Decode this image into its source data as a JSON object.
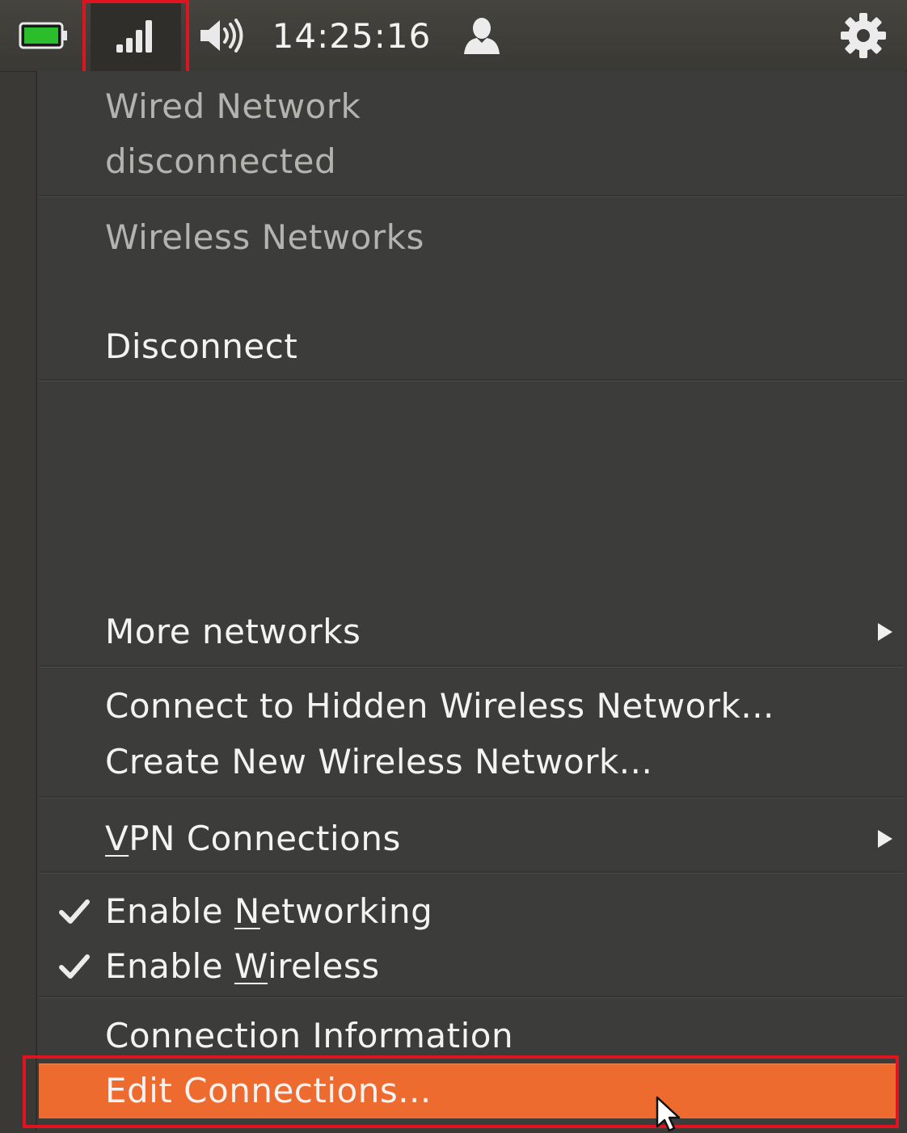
{
  "panel": {
    "battery_icon": "battery-full-icon",
    "network_icon": "network-signal-icon",
    "sound_icon": "speaker-volume-icon",
    "clock": "14:25:16",
    "user_icon": "user-icon",
    "gear_icon": "gear-icon",
    "battery_color": "#2bbd2b",
    "highlight_color": "#e0141e"
  },
  "menu": {
    "wired_title": "Wired Network",
    "wired_status": "disconnected",
    "wireless_header": "Wireless Networks",
    "disconnect": "Disconnect",
    "more_networks": "More networks",
    "connect_hidden": "Connect to Hidden Wireless Network...",
    "create_new": "Create New Wireless Network...",
    "vpn_prefix": "V",
    "vpn_rest": "PN Connections",
    "enable_networking_a": "Enable ",
    "enable_networking_u": "N",
    "enable_networking_b": "etworking",
    "enable_networking_checked": true,
    "enable_wireless_a": "Enable ",
    "enable_wireless_u": "W",
    "enable_wireless_b": "ireless",
    "enable_wireless_checked": true,
    "connection_information": "Connection Information",
    "edit_connections": "Edit Connections...",
    "accent_color": "#ee6b2f"
  }
}
